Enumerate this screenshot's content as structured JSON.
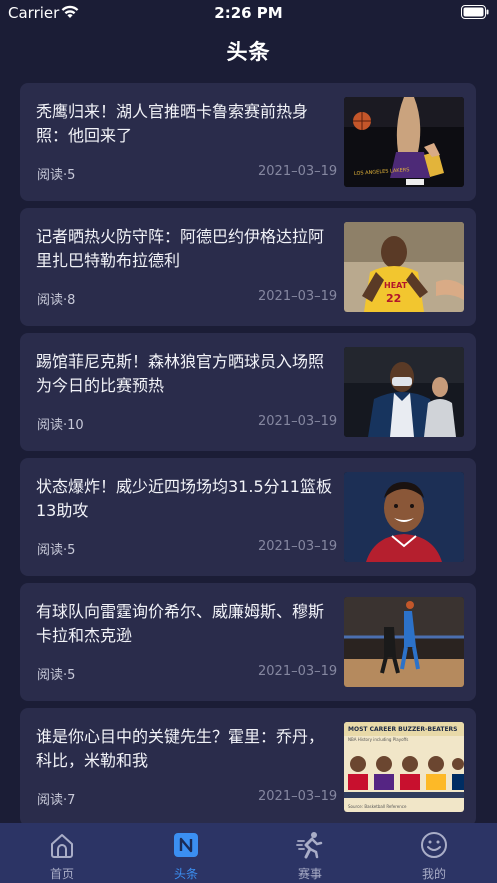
{
  "status_bar": {
    "carrier": "Carrier",
    "time": "2:26 PM"
  },
  "header": {
    "title": "头条"
  },
  "articles": [
    {
      "title": "秃鹰归来！湖人官推晒卡鲁索赛前热身照：他回来了",
      "reads": "阅读·5",
      "date": "2021–03–19",
      "image": "lakers-player-warmup-photo"
    },
    {
      "title": "记者晒热火防守阵：阿德巴约伊格达拉阿里扎巴特勒布拉德利",
      "reads": "阅读·8",
      "date": "2021–03–19",
      "image": "heat-player-photo"
    },
    {
      "title": "踢馆菲尼克斯！森林狼官方晒球员入场照为今日的比赛预热",
      "reads": "阅读·10",
      "date": "2021–03–19",
      "image": "timberwolves-arrival-photo"
    },
    {
      "title": "状态爆炸！威少近四场场均31.5分11篮板13助攻",
      "reads": "阅读·5",
      "date": "2021–03–19",
      "image": "westbrook-illustration"
    },
    {
      "title": "有球队向雷霆询价希尔、威廉姆斯、穆斯卡拉和杰克逊",
      "reads": "阅读·5",
      "date": "2021–03–19",
      "image": "thunder-game-photo"
    },
    {
      "title": "谁是你心目中的关键先生？霍里：乔丹，科比，米勒和我",
      "reads": "阅读·7",
      "date": "2021–03–19",
      "image": "buzzer-beaters-graphic"
    }
  ],
  "thumb_text": {
    "lakers": "LOS ANGELES LAKERS",
    "heat": "HEAT",
    "heat_number": "22",
    "graphic_title": "MOST CAREER BUZZER-BEATERS",
    "graphic_subtitle": "NBA History including Playoffs",
    "graphic_source": "Source: Basketball Reference"
  },
  "tab_bar": {
    "tabs": [
      {
        "label": "首页",
        "icon": "home-icon",
        "active": false
      },
      {
        "label": "头条",
        "icon": "news-icon",
        "active": true
      },
      {
        "label": "赛事",
        "icon": "runner-icon",
        "active": false
      },
      {
        "label": "我的",
        "icon": "smiley-icon",
        "active": false
      }
    ],
    "active_color": "#3b8ff2",
    "inactive_color": "#a9adc7"
  },
  "colors": {
    "background": "#1b1d36",
    "card": "#2a2c4b",
    "tab_bar": "#2c3465"
  }
}
